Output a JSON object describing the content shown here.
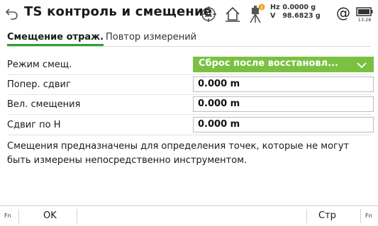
{
  "title": "TS контроль и смещение",
  "status": {
    "hz_label": "Hz",
    "hz_value": "0.0000 g",
    "v_label": "V",
    "v_value": "98.6823 g",
    "at_symbol": "@",
    "battery_time": "13:28",
    "icons": [
      "back-arrow-icon",
      "prism-target-icon",
      "home-icon",
      "instrument-warning-icon",
      "at-icon",
      "battery-icon"
    ]
  },
  "tabs": [
    {
      "label": "Смещение отраж."
    },
    {
      "label": "Повтор измерений"
    }
  ],
  "fields": {
    "mode": {
      "label": "Режим смещ.",
      "value": "Сброс после восстановл..."
    },
    "cross": {
      "label": "Попер. сдвиг",
      "value": "0.000 m"
    },
    "length": {
      "label": "Вел. смещения",
      "value": "0.000 m"
    },
    "height": {
      "label": "Сдвиг по Н",
      "value": "0.000 m"
    }
  },
  "description": "Смещения предназначены для определения точек, которые не могут быть измерены непосредственно инструментом.",
  "softkeys": {
    "fn_left": "Fn",
    "ok": "OK",
    "page": "Стр",
    "fn_right": "Fn"
  },
  "colors": {
    "accent_green": "#7ac142",
    "tab_underline": "#2ea12e",
    "warning_orange": "#f0a020"
  }
}
